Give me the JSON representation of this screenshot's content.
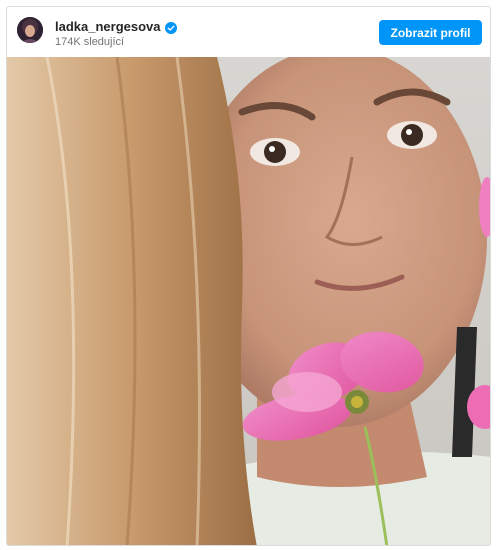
{
  "post": {
    "username": "ladka_nergesova",
    "followers": "174K sledující",
    "profile_button": "Zobrazit profil"
  },
  "colors": {
    "accent": "#0095f6",
    "verified": "#0095f6",
    "card_border": "#dbdbdb"
  },
  "icons": {
    "verified": "verified-badge-icon"
  }
}
